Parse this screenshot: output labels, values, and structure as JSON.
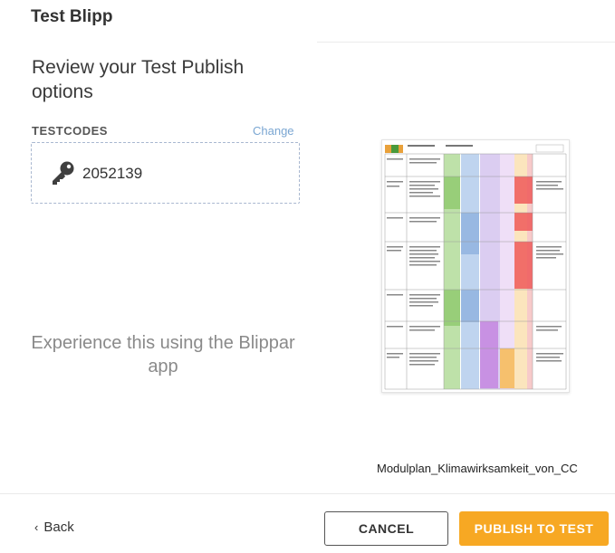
{
  "header": {
    "title": "Test Blipp"
  },
  "review": {
    "heading": "Review your Test Publish options",
    "testcodes_label": "TESTCODES",
    "change_label": "Change",
    "code": "2052139",
    "code_icon": "key-icon"
  },
  "experience_text": "Experience this using the Blippar app",
  "preview": {
    "filename": "Modulplan_Klimawirksamkeit_von_CC",
    "column_colors": [
      "#a8d78c",
      "#a9c6ea",
      "#d7c8ef",
      "#c486e0",
      "#f7bb55",
      "#ee5a5a"
    ]
  },
  "footer": {
    "back_label": "Back",
    "cancel_label": "CANCEL",
    "publish_label": "PUBLISH TO TEST",
    "publish_color": "#f7a823"
  }
}
